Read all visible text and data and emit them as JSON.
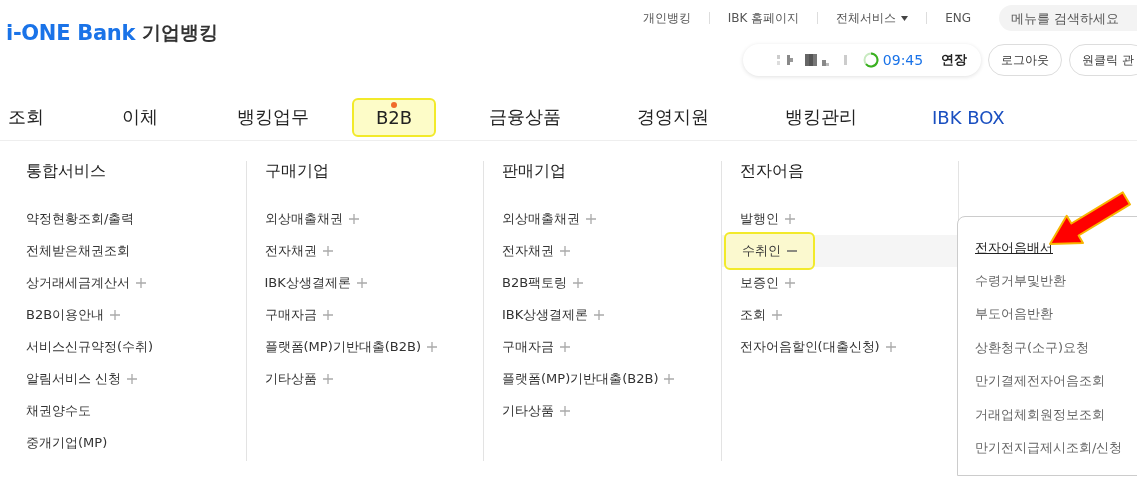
{
  "logo": {
    "brand": "i-ONE Bank",
    "suffix": "기업뱅킹"
  },
  "top_links": [
    {
      "label": "개인뱅킹",
      "dropdown": false
    },
    {
      "label": "IBK 홈페이지",
      "dropdown": false
    },
    {
      "label": "전체서비스",
      "dropdown": true
    },
    {
      "label": "ENG",
      "dropdown": false
    }
  ],
  "search": {
    "placeholder": "메뉴를 검색하세요"
  },
  "session": {
    "time": "09:45",
    "extend_label": "연장",
    "logout_label": "로그아웃",
    "extra_button": "원클릭 관"
  },
  "nav": [
    {
      "label": "조회",
      "selected": false,
      "kind": "normal"
    },
    {
      "label": "이체",
      "selected": false,
      "kind": "normal"
    },
    {
      "label": "뱅킹업무",
      "selected": false,
      "kind": "normal"
    },
    {
      "label": "B2B",
      "selected": true,
      "kind": "normal"
    },
    {
      "label": "금융상품",
      "selected": false,
      "kind": "normal"
    },
    {
      "label": "경영지원",
      "selected": false,
      "kind": "normal"
    },
    {
      "label": "뱅킹관리",
      "selected": false,
      "kind": "normal"
    },
    {
      "label": "IBK BOX",
      "selected": false,
      "kind": "accent"
    }
  ],
  "menu_columns": [
    {
      "title": "통합서비스",
      "items": [
        {
          "label": "약정현황조회/출력",
          "kind": "plain",
          "selected": false
        },
        {
          "label": "전체받은채권조회",
          "kind": "plain",
          "selected": false
        },
        {
          "label": "상거래세금계산서",
          "kind": "plus",
          "selected": false
        },
        {
          "label": "B2B이용안내",
          "kind": "plus",
          "selected": false
        },
        {
          "label": "서비스신규약정(수취)",
          "kind": "plain",
          "selected": false
        },
        {
          "label": "알림서비스 신청",
          "kind": "plus",
          "selected": false
        },
        {
          "label": "채권양수도",
          "kind": "plain",
          "selected": false
        },
        {
          "label": "중개기업(MP)",
          "kind": "plain",
          "selected": false
        }
      ]
    },
    {
      "title": "구매기업",
      "items": [
        {
          "label": "외상매출채권",
          "kind": "plus",
          "selected": false
        },
        {
          "label": "전자채권",
          "kind": "plus",
          "selected": false
        },
        {
          "label": "IBK상생결제론",
          "kind": "plus",
          "selected": false
        },
        {
          "label": "구매자금",
          "kind": "plus",
          "selected": false
        },
        {
          "label": "플랫폼(MP)기반대출(B2B)",
          "kind": "plus",
          "selected": false
        },
        {
          "label": "기타상품",
          "kind": "plus",
          "selected": false
        }
      ]
    },
    {
      "title": "판매기업",
      "items": [
        {
          "label": "외상매출채권",
          "kind": "plus",
          "selected": false
        },
        {
          "label": "전자채권",
          "kind": "plus",
          "selected": false
        },
        {
          "label": "B2B팩토링",
          "kind": "plus",
          "selected": false
        },
        {
          "label": "IBK상생결제론",
          "kind": "plus",
          "selected": false
        },
        {
          "label": "구매자금",
          "kind": "plus",
          "selected": false
        },
        {
          "label": "플랫폼(MP)기반대출(B2B)",
          "kind": "plus",
          "selected": false
        },
        {
          "label": "기타상품",
          "kind": "plus",
          "selected": false
        }
      ]
    },
    {
      "title": "전자어음",
      "items": [
        {
          "label": "발행인",
          "kind": "plus",
          "selected": false
        },
        {
          "label": "수취인",
          "kind": "minus",
          "selected": true
        },
        {
          "label": "보증인",
          "kind": "plus",
          "selected": false
        },
        {
          "label": "조회",
          "kind": "plus",
          "selected": false
        },
        {
          "label": "전자어음할인(대출신청)",
          "kind": "plus",
          "selected": false
        }
      ]
    }
  ],
  "submenu": [
    {
      "label": "전자어음배서",
      "selected": true
    },
    {
      "label": "수령거부및반환",
      "selected": false
    },
    {
      "label": "부도어음반환",
      "selected": false
    },
    {
      "label": "상환청구(소구)요청",
      "selected": false
    },
    {
      "label": "만기결제전자어음조회",
      "selected": false
    },
    {
      "label": "거래업체회원정보조회",
      "selected": false
    },
    {
      "label": "만기전지급제시조회/신청",
      "selected": false
    }
  ]
}
